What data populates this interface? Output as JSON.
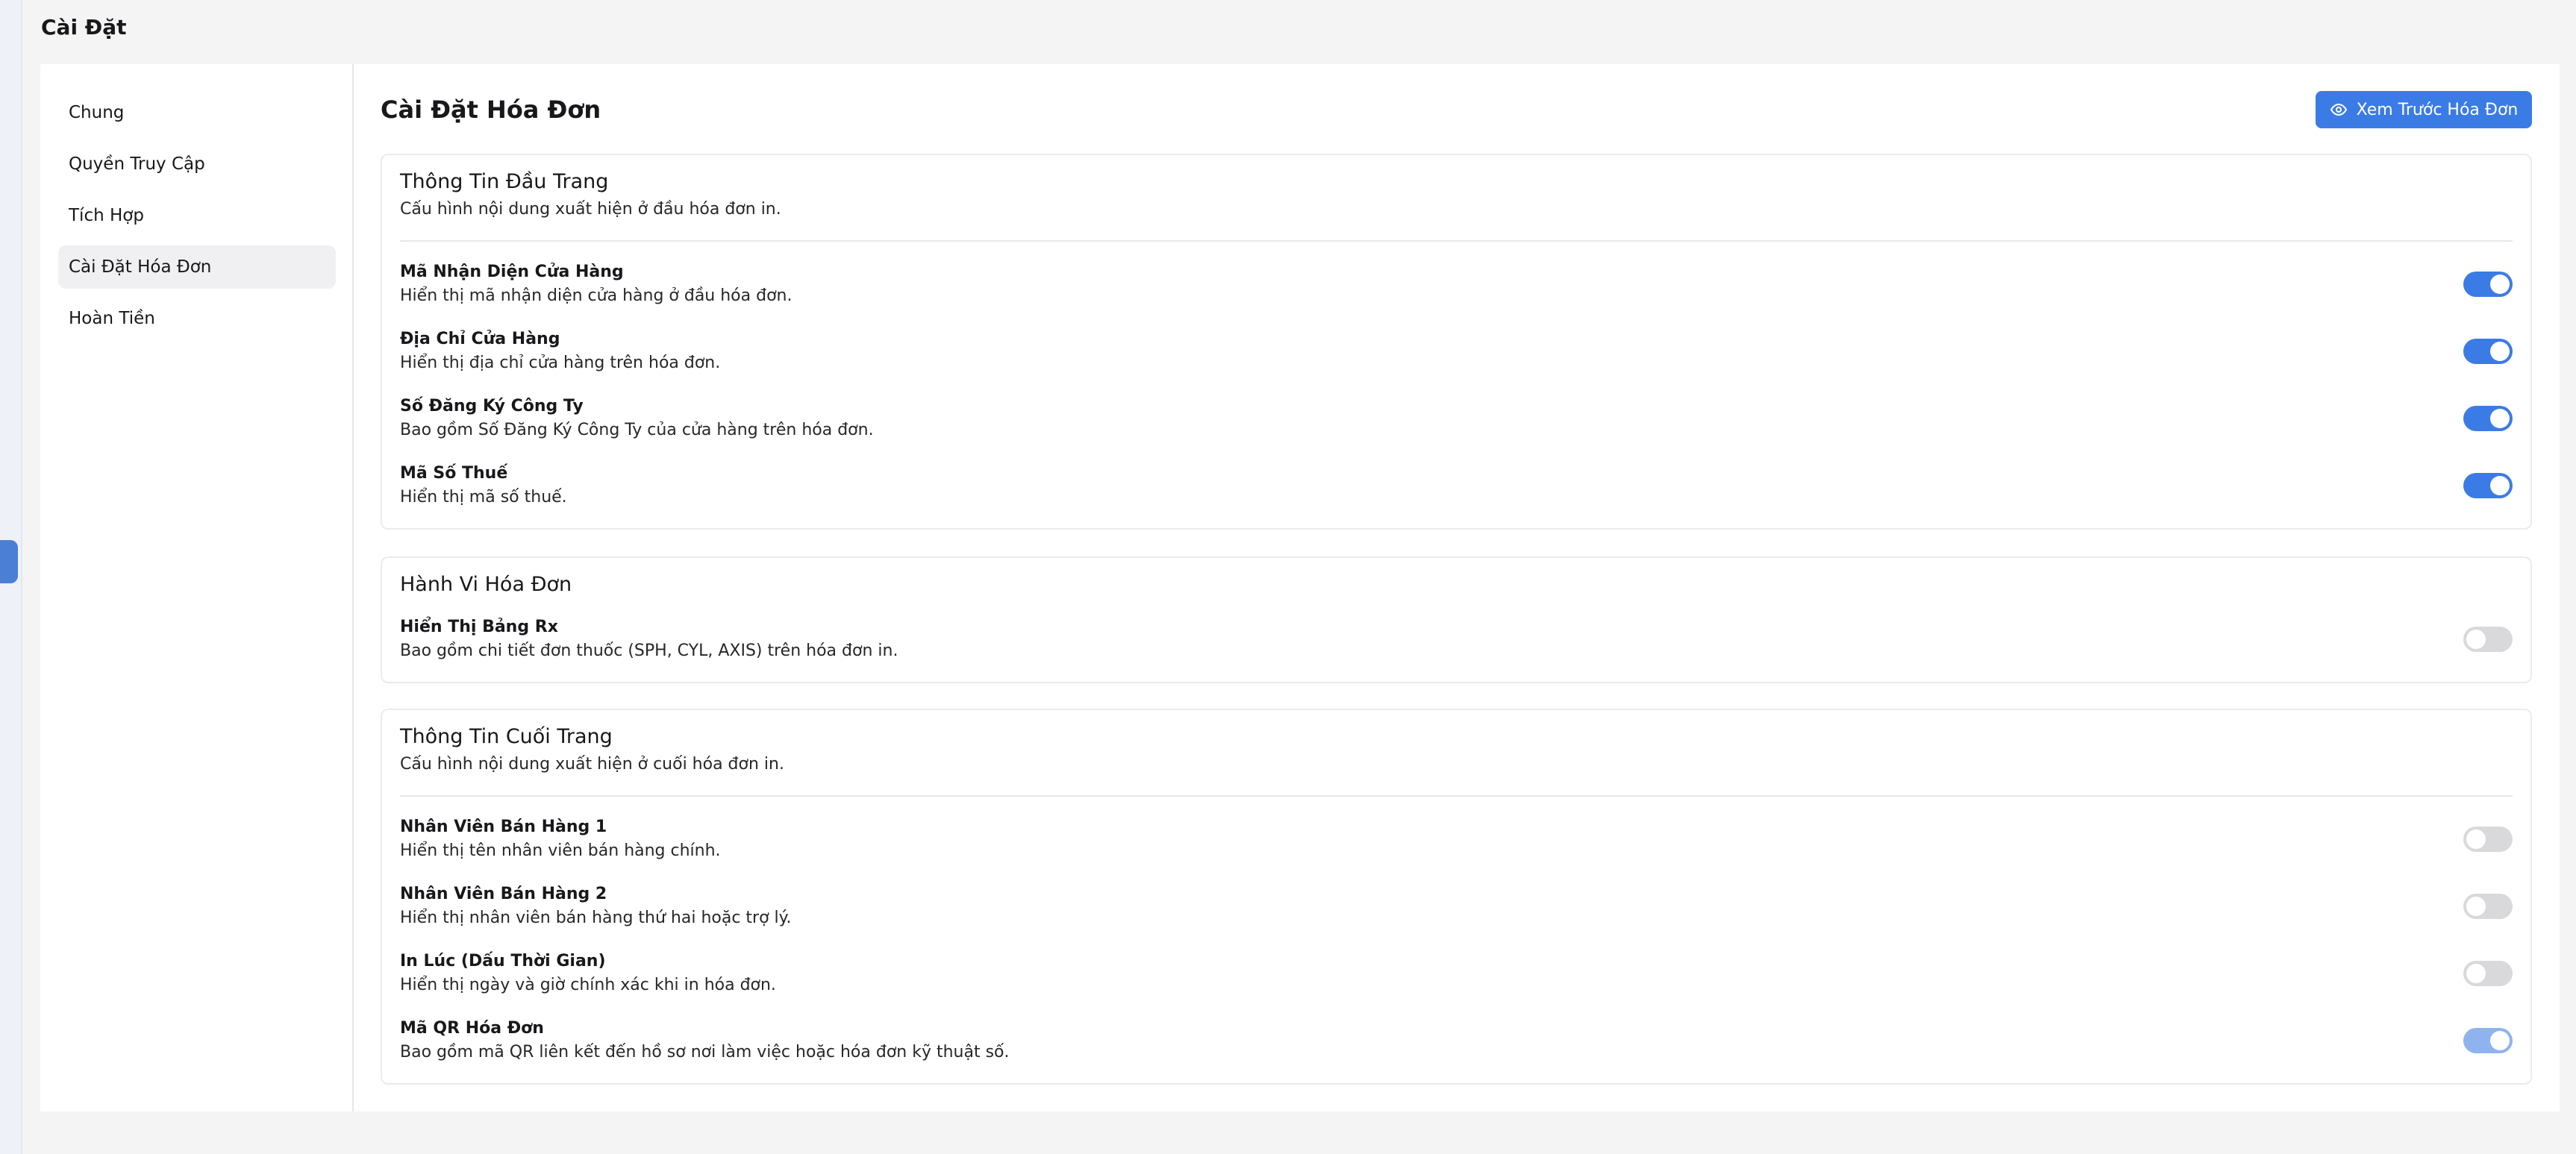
{
  "page_title": "Cài Đặt",
  "nav": [
    {
      "label": "Chung"
    },
    {
      "label": "Quyền Truy Cập"
    },
    {
      "label": "Tích Hợp"
    },
    {
      "label": "Cài Đặt Hóa Đơn",
      "active": true
    },
    {
      "label": "Hoàn Tiền"
    }
  ],
  "main": {
    "title": "Cài Đặt Hóa Đơn",
    "preview_button": "Xem Trước Hóa Đơn",
    "preview_icon": "eye-icon"
  },
  "header_section": {
    "title": "Thông Tin Đầu Trang",
    "desc": "Cấu hình nội dung xuất hiện ở đầu hóa đơn in.",
    "rows": [
      {
        "label": "Mã Nhận Diện Cửa Hàng",
        "desc": "Hiển thị mã nhận diện cửa hàng ở đầu hóa đơn.",
        "enabled": true
      },
      {
        "label": "Địa Chỉ Cửa Hàng",
        "desc": "Hiển thị địa chỉ cửa hàng trên hóa đơn.",
        "enabled": true
      },
      {
        "label": "Số Đăng Ký Công Ty",
        "desc": "Bao gồm Số Đăng Ký Công Ty của cửa hàng trên hóa đơn.",
        "enabled": true
      },
      {
        "label": "Mã Số Thuế",
        "desc": "Hiển thị mã số thuế.",
        "enabled": true
      }
    ]
  },
  "behavior_section": {
    "title": "Hành Vi Hóa Đơn",
    "rows": [
      {
        "label": "Hiển Thị Bảng Rx",
        "desc": "Bao gồm chi tiết đơn thuốc (SPH, CYL, AXIS) trên hóa đơn in.",
        "enabled": false
      }
    ]
  },
  "footer_section": {
    "title": "Thông Tin Cuối Trang",
    "desc": "Cấu hình nội dung xuất hiện ở cuối hóa đơn in.",
    "rows": [
      {
        "label": "Nhân Viên Bán Hàng 1",
        "desc": "Hiển thị tên nhân viên bán hàng chính.",
        "enabled": false
      },
      {
        "label": "Nhân Viên Bán Hàng 2",
        "desc": "Hiển thị nhân viên bán hàng thứ hai hoặc trợ lý.",
        "enabled": false
      },
      {
        "label": "In Lúc (Dấu Thời Gian)",
        "desc": "Hiển thị ngày và giờ chính xác khi in hóa đơn.",
        "enabled": false
      },
      {
        "label": "Mã QR Hóa Đơn",
        "desc": "Bao gồm mã QR liên kết đến hồ sơ nơi làm việc hoặc hóa đơn kỹ thuật số.",
        "enabled": true,
        "disabled_state": true
      }
    ]
  },
  "colors": {
    "accent": "#3b7be5",
    "toggle_off": "#d9d9dc",
    "toggle_on_disabled": "#8fb3ee"
  }
}
